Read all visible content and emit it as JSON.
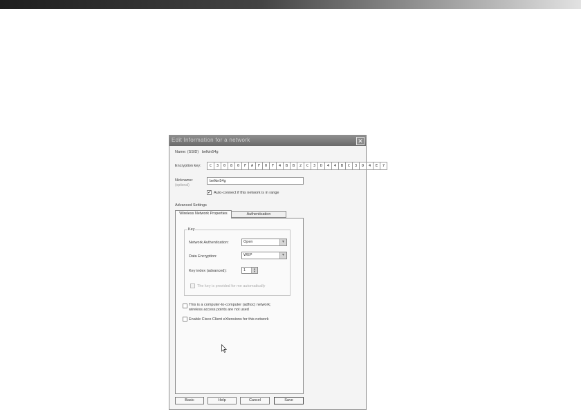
{
  "window": {
    "title": "Edit Information for a network",
    "close_glyph": "✕"
  },
  "network": {
    "name_label": "Name: (SSID)",
    "name_value": "belkin54g",
    "encryption_key_label": "Encryption key:",
    "encryption_key_chars": [
      "C",
      "3",
      "0",
      "8",
      "0",
      "F",
      "A",
      "F",
      "0",
      "F",
      "4",
      "B",
      "B",
      "2",
      "C",
      "3",
      "D",
      "4",
      "4",
      "B",
      "C",
      "3",
      "D",
      "4",
      "E",
      "7"
    ],
    "nickname_label": "Nickname:",
    "nickname_hint": "(optional)",
    "nickname_value": "belkin54g",
    "auto_connect_label": "Auto-connect if this network is in range",
    "auto_connect_checked": true
  },
  "advanced": {
    "section_label": "Advanced Settings",
    "tabs": [
      {
        "label": "Wireless Network Properties",
        "active": true
      },
      {
        "label": "Authentication",
        "active": false
      }
    ],
    "key_group_label": "Key",
    "network_auth_label": "Network Authentication:",
    "network_auth_value": "Open",
    "data_encryption_label": "Data Encryption:",
    "data_encryption_value": "WEP",
    "key_index_label": "Key index (advanced):",
    "key_index_value": "1",
    "key_provided_label": "The key is provided for me automatically",
    "key_provided_checked": false,
    "adhoc_label_line1": "This is a computer-to-computer (adhoc) network;",
    "adhoc_label_line2": "wireless access points are not used",
    "adhoc_checked": false,
    "cisco_label": "Enable Cisco Client eXtensions for this network",
    "cisco_checked": false
  },
  "buttons": {
    "basic": "Basic",
    "help": "Help",
    "cancel": "Cancel",
    "save": "Save"
  },
  "icons": {
    "close": "close-icon",
    "dropdown": "chevron-down-icon",
    "spinner": "spinner-arrows-icon",
    "cursor": "mouse-pointer-icon"
  }
}
